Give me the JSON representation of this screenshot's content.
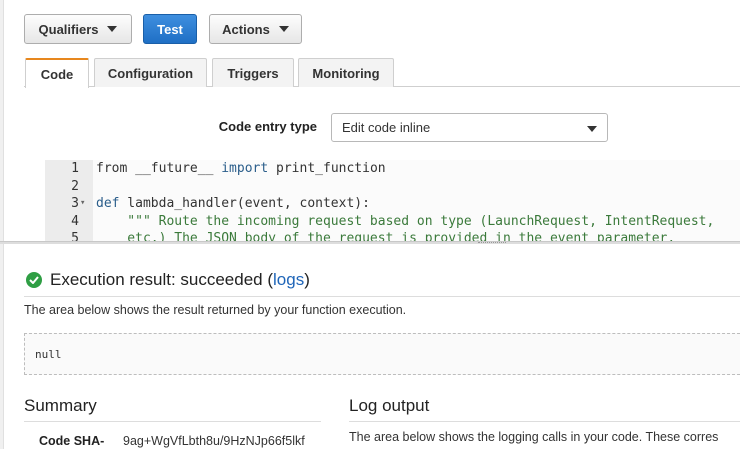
{
  "toolbar": {
    "qualifiers_label": "Qualifiers",
    "test_label": "Test",
    "actions_label": "Actions"
  },
  "tabs": [
    {
      "label": "Code",
      "active": true
    },
    {
      "label": "Configuration",
      "active": false
    },
    {
      "label": "Triggers",
      "active": false
    },
    {
      "label": "Monitoring",
      "active": false
    }
  ],
  "code_entry": {
    "label": "Code entry type",
    "selected": "Edit code inline"
  },
  "editor": {
    "lines": [
      {
        "num": "1",
        "fold": false,
        "parts": [
          {
            "text": "from __future__ ",
            "cls": ""
          },
          {
            "text": "import",
            "cls": "kw"
          },
          {
            "text": " print_function",
            "cls": ""
          }
        ]
      },
      {
        "num": "2",
        "fold": false,
        "parts": []
      },
      {
        "num": "3",
        "fold": true,
        "parts": [
          {
            "text": "def",
            "cls": "kw"
          },
          {
            "text": " lambda_handler(event, context):",
            "cls": ""
          }
        ]
      },
      {
        "num": "4",
        "fold": false,
        "parts": [
          {
            "text": "    \"\"\" Route the incoming request based on type (LaunchRequest, IntentRequest,",
            "cls": "comment-text"
          }
        ]
      },
      {
        "num": "5",
        "fold": false,
        "parts": [
          {
            "text": "    etc.) The JSON body of the request is provided in the event parameter.",
            "cls": "comment-text"
          }
        ]
      }
    ]
  },
  "execution": {
    "title_prefix": "Execution result: succeeded (",
    "logs_link": "logs",
    "title_suffix": ")",
    "description": "The area below shows the result returned by your function execution.",
    "result": "null",
    "status_color": "#2f9e44"
  },
  "summary": {
    "title": "Summary",
    "key": "Code SHA-",
    "value": "9ag+WgVfLbth8u/9HzNJp66f5lkf"
  },
  "log_output": {
    "title": "Log output",
    "description": "The area below shows the logging calls in your code. These corres"
  },
  "icons": {
    "qualifiers_caret": "caret-down",
    "actions_caret": "caret-down",
    "select_caret": "caret-down",
    "status": "check-circle"
  }
}
